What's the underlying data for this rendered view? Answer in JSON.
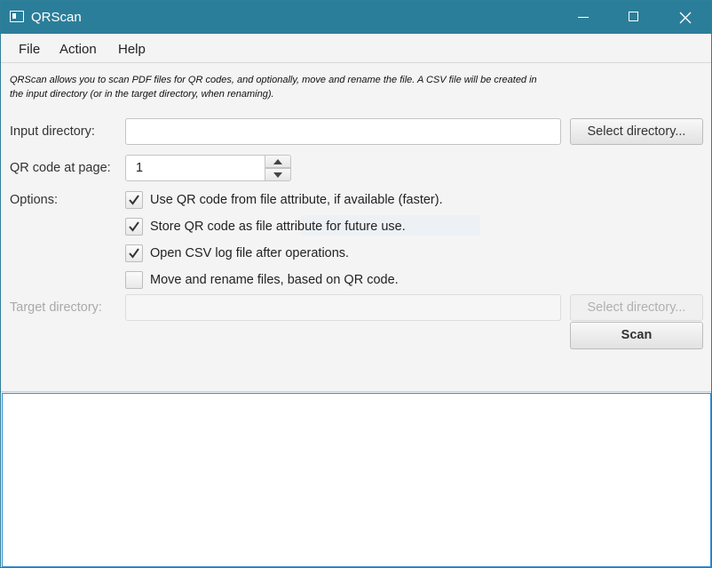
{
  "window": {
    "title": "QRScan"
  },
  "menu": {
    "file": "File",
    "action": "Action",
    "help": "Help"
  },
  "description": "QRScan allows you to scan PDF files for QR codes, and optionally, move and rename the file. A CSV file will be created in the input directory (or in the target directory, when renaming).",
  "input_directory": {
    "label": "Input directory:",
    "value": "",
    "button": "Select directory..."
  },
  "qr_page": {
    "label": "QR code at page:",
    "value": "1"
  },
  "options": {
    "label": "Options:",
    "items": [
      {
        "label": "Use QR code from file attribute, if available (faster).",
        "checked": true
      },
      {
        "label": "Store QR code as file attribute for future use.",
        "checked": true
      },
      {
        "label": "Open CSV log file after operations.",
        "checked": true
      },
      {
        "label": "Move and rename files, based on QR code.",
        "checked": false
      }
    ]
  },
  "target_directory": {
    "label": "Target directory:",
    "value": "",
    "button": "Select directory..."
  },
  "scan_button": "Scan",
  "log": {
    "content": ""
  }
}
